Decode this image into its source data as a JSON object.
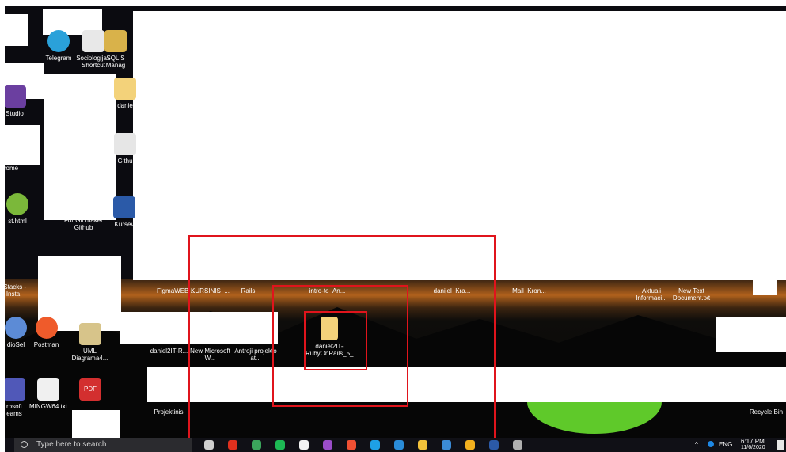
{
  "desktop": {
    "icons": [
      {
        "label": "Telegram",
        "color": "#2aa1da"
      },
      {
        "label": "Sociologija - Shortcut",
        "color": "#e8e8e8"
      },
      {
        "label": "SQL S Manag",
        "color": "#d9b24a"
      },
      {
        "label": "Studio",
        "color": "#6b3fa0"
      },
      {
        "label": "danie",
        "color": "#f3d27a"
      },
      {
        "label": "Githu",
        "color": "#e6e6e6"
      },
      {
        "label": "rome",
        "color": "#3c8b3c"
      },
      {
        "label": "st.html",
        "color": "#7bb83a"
      },
      {
        "label": "For Gif maker Github",
        "color": "#1e88e5"
      },
      {
        "label": "Kursev",
        "color": "#2b5aa8"
      },
      {
        "label": "eStacks -Insta",
        "color": "#20242b"
      },
      {
        "label": "dioSel",
        "color": "#5c8bd6"
      },
      {
        "label": "Postman",
        "color": "#ef5b2b"
      },
      {
        "label": "UML Diagrama4...",
        "color": "#d7c48a"
      },
      {
        "label": "rosoft eams",
        "color": "#5058b8"
      },
      {
        "label": "MINGW64.txt",
        "color": "#f0f0f0"
      },
      {
        "label": "PDF",
        "color": "#d32f2f"
      },
      {
        "label": "FigmaWEB...",
        "color": "#000000"
      },
      {
        "label": "KURSINIS_...",
        "color": "#000000"
      },
      {
        "label": "Rails",
        "color": "#000000"
      },
      {
        "label": "intro-to_An...",
        "color": "#000000"
      },
      {
        "label": "danijel_Kra...",
        "color": "#000000"
      },
      {
        "label": "Mail_Kron...",
        "color": "#000000"
      },
      {
        "label": "Aktuali Informaci...",
        "color": "#000000"
      },
      {
        "label": "New Text Document.txt",
        "color": "#000000"
      },
      {
        "label": "daniel2IT-R...",
        "color": "#000000"
      },
      {
        "label": "New Microsoft W...",
        "color": "#000000"
      },
      {
        "label": "Antroji projekto at...",
        "color": "#000000"
      },
      {
        "label": "daniel2IT-RubyOnRails_5_",
        "color": "#f3d27a"
      },
      {
        "label": "Projektinis",
        "color": "#000000"
      },
      {
        "label": "Recycle Bin",
        "color": "#000000"
      }
    ]
  },
  "taskbar": {
    "search_placeholder": "Type here to search",
    "lang": "ENG",
    "time": "6:17 PM",
    "date": "11/6/2020",
    "apps": [
      {
        "name": "task-view-icon",
        "color": "#cfcfcf"
      },
      {
        "name": "opera-icon",
        "color": "#e0301e"
      },
      {
        "name": "chrome-green-icon",
        "color": "#3ba55c"
      },
      {
        "name": "spotify-icon",
        "color": "#1db954"
      },
      {
        "name": "store-icon",
        "color": "#f2f2f2"
      },
      {
        "name": "purple-app-icon",
        "color": "#9b4dca"
      },
      {
        "name": "git-icon",
        "color": "#f05033"
      },
      {
        "name": "edge-icon",
        "color": "#1ea0e6"
      },
      {
        "name": "vscode-icon",
        "color": "#2a8cd8"
      },
      {
        "name": "explorer-icon",
        "color": "#f3c23a"
      },
      {
        "name": "mail-icon",
        "color": "#3b8bd6"
      },
      {
        "name": "chrome-icon",
        "color": "#f2b01e"
      },
      {
        "name": "word-icon",
        "color": "#2b5aa8"
      },
      {
        "name": "bird-icon",
        "color": "#b0b0b0"
      }
    ]
  },
  "colors": {
    "highlight": "#e0141c"
  }
}
